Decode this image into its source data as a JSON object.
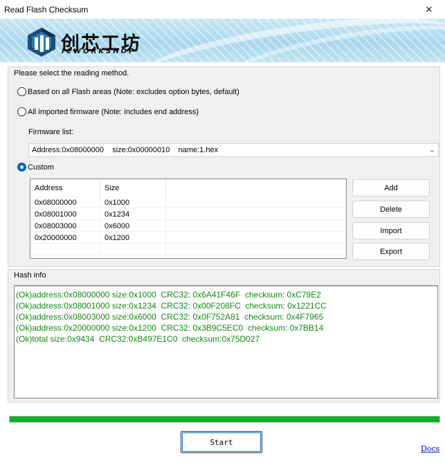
{
  "window": {
    "title": "Read Flash Checksum",
    "close_symbol": "✕"
  },
  "banner": {
    "brand_cn": "创芯工坊",
    "brand_en": "ICWORKSHOP"
  },
  "method": {
    "legend": "Please select the reading method.",
    "options": [
      {
        "label": "Based on all Flash areas (Note: excludes option bytes, default)",
        "checked": false
      },
      {
        "label": "All imported firmware (Note: includes end address)",
        "checked": false
      },
      {
        "label": "Custom",
        "checked": true
      }
    ],
    "firmware_list_label": "Firmware list:",
    "firmware_selected": "Address:0x08000000    size:0x00000010    name:1.hex"
  },
  "table": {
    "headers": [
      "Address",
      "Size",
      ""
    ],
    "rows": [
      {
        "address": "0x08000000",
        "size": "0x1000"
      },
      {
        "address": "0x08001000",
        "size": "0x1234"
      },
      {
        "address": "0x08003000",
        "size": "0x6000"
      },
      {
        "address": "0x20000000",
        "size": "0x1200"
      },
      {
        "address": "",
        "size": ""
      }
    ]
  },
  "buttons": {
    "add": "Add",
    "delete": "Delete",
    "import": "Import",
    "export": "Export",
    "start": "Start"
  },
  "hash": {
    "legend": "Hash info",
    "lines": [
      "(Ok)address:0x08000000 size:0x1000  CRC32: 0x6A41F46F  checksum: 0xC79E2",
      "(Ok)address:0x08001000 size:0x1234  CRC32: 0x00F208FC  checksum: 0x1221CC",
      "(Ok)address:0x08003000 size:0x6000  CRC32: 0x0F752A81  checksum: 0x4F7965",
      "(Ok)address:0x20000000 size:0x1200  CRC32: 0x3B9C5EC0  checksum: 0x7BB14",
      "(Ok)total size:0x9434  CRC32:0xB497E1C0  checksum:0x75D027"
    ],
    "text_color": "#118a11"
  },
  "progress": {
    "fraction": 1.0,
    "color": "#06b025"
  },
  "docs_link": "Docs"
}
